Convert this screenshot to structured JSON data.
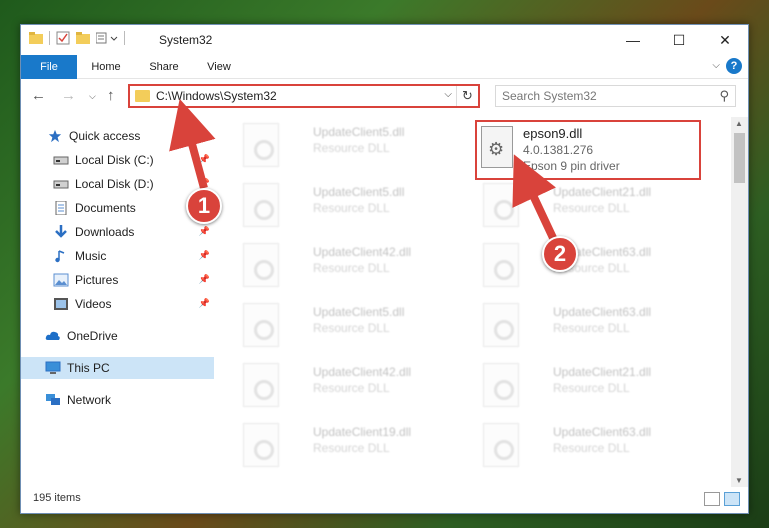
{
  "window": {
    "title": "System32",
    "controls": {
      "minimize": "—",
      "maximize": "☐",
      "close": "✕"
    }
  },
  "ribbon": {
    "tabs": [
      "File",
      "Home",
      "Share",
      "View"
    ],
    "help": "?"
  },
  "address": {
    "path": "C:\\Windows\\System32"
  },
  "search": {
    "placeholder": "Search System32"
  },
  "sidebar": {
    "items": [
      {
        "label": "Quick access",
        "icon": "star-icon",
        "pinned": false
      },
      {
        "label": "Local Disk (C:)",
        "icon": "drive-icon",
        "pinned": true
      },
      {
        "label": "Local Disk (D:)",
        "icon": "drive-icon",
        "pinned": true
      },
      {
        "label": "Documents",
        "icon": "documents-icon",
        "pinned": true
      },
      {
        "label": "Downloads",
        "icon": "download-icon",
        "pinned": true
      },
      {
        "label": "Music",
        "icon": "music-icon",
        "pinned": true
      },
      {
        "label": "Pictures",
        "icon": "pictures-icon",
        "pinned": true
      },
      {
        "label": "Videos",
        "icon": "videos-icon",
        "pinned": true
      },
      {
        "label": "OneDrive",
        "icon": "cloud-icon",
        "pinned": false
      },
      {
        "label": "This PC",
        "icon": "computer-icon",
        "pinned": false,
        "selected": true
      },
      {
        "label": "Network",
        "icon": "network-icon",
        "pinned": false
      }
    ]
  },
  "files": {
    "highlighted": {
      "name": "epson9.dll",
      "version": "4.0.1381.276",
      "description": "Epson 9 pin driver"
    },
    "left_column": [
      {
        "name": "UpdateClient5.dll",
        "desc": "Resource DLL"
      },
      {
        "name": "UpdateClient5.dll",
        "desc": "Resource DLL"
      },
      {
        "name": "UpdateClient42.dll",
        "desc": "Resource DLL"
      },
      {
        "name": "UpdateClient5.dll",
        "desc": "Resource DLL"
      },
      {
        "name": "UpdateClient42.dll",
        "desc": "Resource DLL"
      },
      {
        "name": "UpdateClient19.dll",
        "desc": "Resource DLL"
      }
    ],
    "right_column": [
      {
        "name": "UpdateClient21.dll",
        "desc": "Resource DLL"
      },
      {
        "name": "UpdateClient63.dll",
        "desc": "Resource DLL"
      },
      {
        "name": "UpdateClient63.dll",
        "desc": "Resource DLL"
      },
      {
        "name": "UpdateClient21.dll",
        "desc": "Resource DLL"
      },
      {
        "name": "UpdateClient63.dll",
        "desc": "Resource DLL"
      }
    ]
  },
  "status": {
    "item_count": "195 items"
  },
  "annotations": {
    "marker1": "1",
    "marker2": "2",
    "color": "#d9433b"
  }
}
